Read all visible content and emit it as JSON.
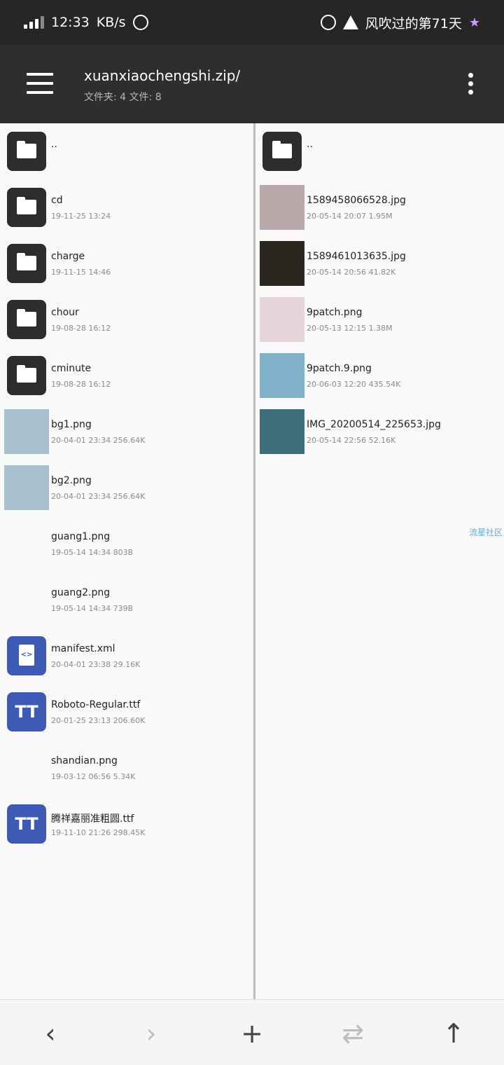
{
  "status": {
    "time": "12:33",
    "speed": "KB/s",
    "carrier_text": "风吹过的第71天"
  },
  "toolbar": {
    "path": "xuanxiaochengshi.zip/",
    "counts": "文件夹: 4   文件: 8"
  },
  "left_pane": [
    {
      "name": "..",
      "meta": "",
      "kind": "folder"
    },
    {
      "name": "cd",
      "meta": "19-11-25 13:24",
      "kind": "folder"
    },
    {
      "name": "charge",
      "meta": "19-11-15 14:46",
      "kind": "folder"
    },
    {
      "name": "chour",
      "meta": "19-08-28 16:12",
      "kind": "folder"
    },
    {
      "name": "cminute",
      "meta": "19-08-28 16:12",
      "kind": "folder"
    },
    {
      "name": "bg1.png",
      "meta": "20-04-01 23:34   256.64K",
      "kind": "image",
      "color": "#a7c1cd"
    },
    {
      "name": "bg2.png",
      "meta": "20-04-01 23:34   256.64K",
      "kind": "image",
      "color": "#a7c1cd"
    },
    {
      "name": "guang1.png",
      "meta": "19-05-14 14:34   803B",
      "kind": "blank"
    },
    {
      "name": "guang2.png",
      "meta": "19-05-14 14:34   739B",
      "kind": "blank"
    },
    {
      "name": "manifest.xml",
      "meta": "20-04-01 23:38   29.16K",
      "kind": "xml"
    },
    {
      "name": "Roboto-Regular.ttf",
      "meta": "20-01-25 23:13   206.60K",
      "kind": "font"
    },
    {
      "name": "shandian.png",
      "meta": "19-03-12 06:56   5.34K",
      "kind": "blank"
    },
    {
      "name": "腾祥嘉丽准粗圆.ttf",
      "meta": "19-11-10 21:26   298.45K",
      "kind": "font"
    }
  ],
  "right_pane": [
    {
      "name": "..",
      "meta": "",
      "kind": "folder"
    },
    {
      "name": "1589458066528.jpg",
      "meta": "20-05-14 20:07   1.95M",
      "kind": "image",
      "color": "#b9a9ab"
    },
    {
      "name": "1589461013635.jpg",
      "meta": "20-05-14 20:56   41.82K",
      "kind": "image",
      "color": "#2b2620"
    },
    {
      "name": "9patch.png",
      "meta": "20-05-13 12:15   1.38M",
      "kind": "image",
      "color": "#e6d6dc"
    },
    {
      "name": "9patch.9.png",
      "meta": "20-06-03 12:20   435.54K",
      "kind": "image",
      "color": "#7fb2c9"
    },
    {
      "name": "IMG_20200514_225653.jpg",
      "meta": "20-05-14 22:56   52.16K",
      "kind": "image",
      "color": "#3e6e7a"
    }
  ],
  "watermark": "流星社区",
  "bottom_bar": {
    "back": "‹",
    "forward": "›",
    "add": "+",
    "swap": "⇄",
    "up": "↑"
  }
}
